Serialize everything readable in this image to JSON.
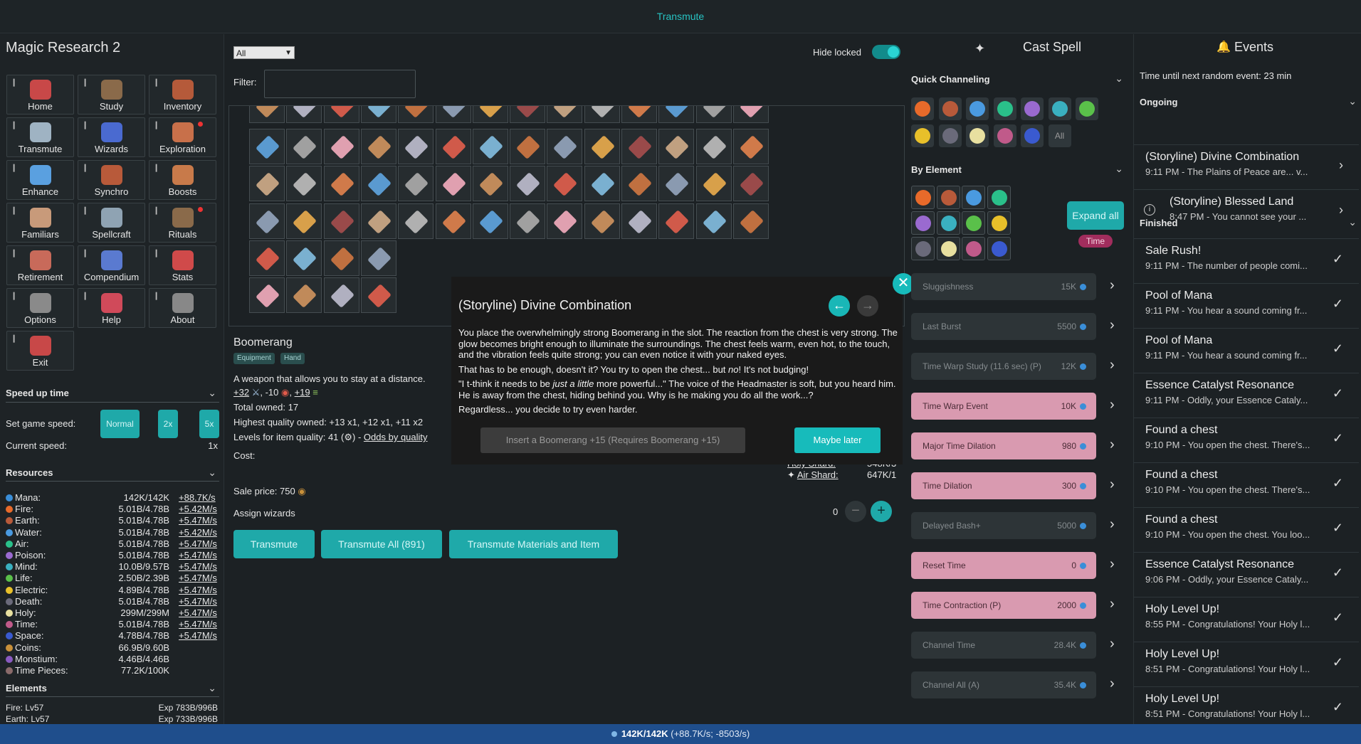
{
  "topbar": {
    "title": "Transmute"
  },
  "app_name": "Magic Research 2",
  "nav": [
    {
      "label": "Home",
      "color": "#c84848"
    },
    {
      "label": "Study",
      "color": "#8a6a4a"
    },
    {
      "label": "Inventory",
      "color": "#b55a3a"
    },
    {
      "label": "Transmute",
      "color": "#9fb3c3"
    },
    {
      "label": "Wizards",
      "color": "#4a6ad0"
    },
    {
      "label": "Exploration",
      "color": "#c8704a"
    },
    {
      "label": "Enhance",
      "color": "#5aa0e0"
    },
    {
      "label": "Synchro",
      "color": "#b85a3a"
    },
    {
      "label": "Boosts",
      "color": "#c87a4a"
    },
    {
      "label": "Familiars",
      "color": "#c89a7a"
    },
    {
      "label": "Spellcraft",
      "color": "#8fa3b3"
    },
    {
      "label": "Rituals",
      "color": "#8a6a4a"
    },
    {
      "label": "Retirement",
      "color": "#c86a5a"
    },
    {
      "label": "Compendium",
      "color": "#5a7ad0"
    },
    {
      "label": "Stats",
      "color": "#d04a4a"
    },
    {
      "label": "Options",
      "color": "#8a8a8a"
    },
    {
      "label": "Help",
      "color": "#d04a5a"
    },
    {
      "label": "About",
      "color": "#888888"
    },
    {
      "label": "Exit",
      "color": "#c84848"
    }
  ],
  "speed": {
    "title": "Speed up time",
    "set_label": "Set game speed:",
    "buttons": [
      "Normal",
      "2x",
      "5x"
    ],
    "current_label": "Current speed:",
    "current_value": "1x"
  },
  "resources": {
    "title": "Resources",
    "rows": [
      {
        "name": "Mana:",
        "amount": "142K/142K",
        "rate": "+88.7K/s",
        "color": "#3a8ed8"
      },
      {
        "name": "Fire:",
        "amount": "5.01B/4.78B",
        "rate": "+5.42M/s",
        "color": "#e86a2a"
      },
      {
        "name": "Earth:",
        "amount": "5.01B/4.78B",
        "rate": "+5.47M/s",
        "color": "#b85a3a"
      },
      {
        "name": "Water:",
        "amount": "5.01B/4.78B",
        "rate": "+5.42M/s",
        "color": "#4a9ae0"
      },
      {
        "name": "Air:",
        "amount": "5.01B/4.78B",
        "rate": "+5.47M/s",
        "color": "#2ac08a"
      },
      {
        "name": "Poison:",
        "amount": "5.01B/4.78B",
        "rate": "+5.47M/s",
        "color": "#9a6ad0"
      },
      {
        "name": "Mind:",
        "amount": "10.0B/9.57B",
        "rate": "+5.47M/s",
        "color": "#3ab0c0"
      },
      {
        "name": "Life:",
        "amount": "2.50B/2.39B",
        "rate": "+5.47M/s",
        "color": "#5ac04a"
      },
      {
        "name": "Electric:",
        "amount": "4.89B/4.78B",
        "rate": "+5.47M/s",
        "color": "#e8c02a"
      },
      {
        "name": "Death:",
        "amount": "5.01B/4.78B",
        "rate": "+5.47M/s",
        "color": "#6a6a7a"
      },
      {
        "name": "Holy:",
        "amount": "299M/299M",
        "rate": "+5.47M/s",
        "color": "#e8e0a0"
      },
      {
        "name": "Time:",
        "amount": "5.01B/4.78B",
        "rate": "+5.47M/s",
        "color": "#c05a8a"
      },
      {
        "name": "Space:",
        "amount": "4.78B/4.78B",
        "rate": "+5.47M/s",
        "color": "#3a5ad0"
      },
      {
        "name": "Coins:",
        "amount": "66.9B/9.60B",
        "rate": "",
        "color": "#c8903a"
      },
      {
        "name": "Monstium:",
        "amount": "4.46B/4.46B",
        "rate": "",
        "color": "#8a5ac0"
      },
      {
        "name": "Time Pieces:",
        "amount": "77.2K/100K",
        "rate": "",
        "color": "#8a6a6a"
      }
    ]
  },
  "elements": {
    "title": "Elements",
    "rows": [
      {
        "name": "Fire: Lv57",
        "exp": "Exp 783B/996B"
      },
      {
        "name": "Earth: Lv57",
        "exp": "Exp 733B/996B"
      }
    ]
  },
  "center": {
    "select_value": "All",
    "hide_locked_label": "Hide locked",
    "filter_label": "Filter:",
    "filter_value": "",
    "item": {
      "name": "Boomerang",
      "tags": [
        "Equipment",
        "Hand"
      ],
      "description": "A weapon that allows you to stay at a distance.",
      "stats": [
        "+32",
        "-10",
        "+19"
      ],
      "total_owned": "Total owned: 17",
      "highest_quality": "Highest quality owned: +13 x1, +12 x1, +11 x2",
      "levels_label": "Levels for item quality: 41 (",
      "levels_suffix": ") -",
      "odds_link": "Odds by quality",
      "cost_label": "Cost:",
      "cost_rows": [
        {
          "name": "Holy Shard:",
          "value": "548K/3"
        },
        {
          "name": "Air Shard:",
          "value": "647K/1"
        }
      ],
      "sale_price": "Sale price: 750",
      "assign_label": "Assign wizards",
      "wizard_count": "0"
    },
    "buttons": [
      "Transmute",
      "Transmute All (891)",
      "Transmute Materials and Item"
    ]
  },
  "modal": {
    "title": "(Storyline) Divine Combination",
    "p1": "You place the overwhelmingly strong Boomerang in the slot. The reaction from the chest is very strong. The glow becomes bright enough to illuminate the surroundings. The chest feels warm, even hot, to the touch, and the vibration feels quite strong; you can even notice it with your naked eyes.",
    "p2a": "That has to be enough, doesn't it? You try to open the chest... but ",
    "p2em": "no",
    "p2b": "! It's not budging!",
    "p3a": "\"I t-think it needs to be ",
    "p3em": "just a little",
    "p3b": " more powerful...\" The voice of the Headmaster is soft, but you heard him. He is away from the chest, hiding behind you. Why is he making you do all the work...?",
    "p4": "Regardless... you decide to try even harder.",
    "insert_label": "Insert a Boomerang +15 (Requires Boomerang +15)",
    "later_label": "Maybe later"
  },
  "spell": {
    "title": "Cast Spell",
    "quick_title": "Quick Channeling",
    "quick_all": "All",
    "by_element_title": "By Element",
    "expand_label": "Expand all",
    "time_badge": "Time",
    "rows": [
      {
        "name": "Sluggishness",
        "cost": "15K",
        "state": "dim"
      },
      {
        "name": "Last Burst",
        "cost": "5500",
        "state": "dim"
      },
      {
        "name": "Time Warp Study (11.6 sec) (P)",
        "cost": "12K",
        "state": "dim"
      },
      {
        "name": "Time Warp Event",
        "cost": "10K",
        "state": "active"
      },
      {
        "name": "Major Time Dilation",
        "cost": "980",
        "state": "active"
      },
      {
        "name": "Time Dilation",
        "cost": "300",
        "state": "active"
      },
      {
        "name": "Delayed Bash+",
        "cost": "5000",
        "state": "dim"
      },
      {
        "name": "Reset Time",
        "cost": "0",
        "state": "active"
      },
      {
        "name": "Time Contraction (P)",
        "cost": "2000",
        "state": "active"
      },
      {
        "name": "Channel Time",
        "cost": "28.4K",
        "state": "dim"
      },
      {
        "name": "Channel All (A)",
        "cost": "35.4K",
        "state": "dim"
      }
    ],
    "orb_colors": [
      "#e86a2a",
      "#b85a3a",
      "#4a9ae0",
      "#2ac08a",
      "#9a6ad0",
      "#3ab0c0",
      "#5ac04a",
      "#e8c02a",
      "#6a6a7a",
      "#e8e0a0",
      "#c05a8a",
      "#3a5ad0"
    ]
  },
  "events": {
    "title": "Events",
    "next_event": "Time until next random event: 23 min",
    "ongoing_title": "Ongoing",
    "finished_title": "Finished",
    "ongoing": [
      {
        "title": "(Storyline) Divine Combination",
        "desc": "9:11 PM - The Plains of Peace are... v..."
      },
      {
        "title": "(Storyline) Blessed Land",
        "desc": "8:47 PM - You cannot see your ..."
      }
    ],
    "finished": [
      {
        "title": "Sale Rush!",
        "desc": "9:11 PM - The number of people comi..."
      },
      {
        "title": "Pool of Mana",
        "desc": "9:11 PM - You hear a sound coming fr..."
      },
      {
        "title": "Pool of Mana",
        "desc": "9:11 PM - You hear a sound coming fr..."
      },
      {
        "title": "Essence Catalyst Resonance",
        "desc": "9:11 PM - Oddly, your Essence Cataly..."
      },
      {
        "title": "Found a chest",
        "desc": "9:10 PM - You open the chest. There's..."
      },
      {
        "title": "Found a chest",
        "desc": "9:10 PM - You open the chest. There's..."
      },
      {
        "title": "Found a chest",
        "desc": "9:10 PM - You open the chest. You loo..."
      },
      {
        "title": "Essence Catalyst Resonance",
        "desc": "9:06 PM - Oddly, your Essence Cataly..."
      },
      {
        "title": "Holy Level Up!",
        "desc": "8:55 PM - Congratulations! Your Holy l..."
      },
      {
        "title": "Holy Level Up!",
        "desc": "8:51 PM - Congratulations! Your Holy l..."
      },
      {
        "title": "Holy Level Up!",
        "desc": "8:51 PM - Congratulations! Your Holy l..."
      }
    ]
  },
  "footer": {
    "mana": "142K/142K",
    "rates": "(+88.7K/s; -8503/s)"
  }
}
